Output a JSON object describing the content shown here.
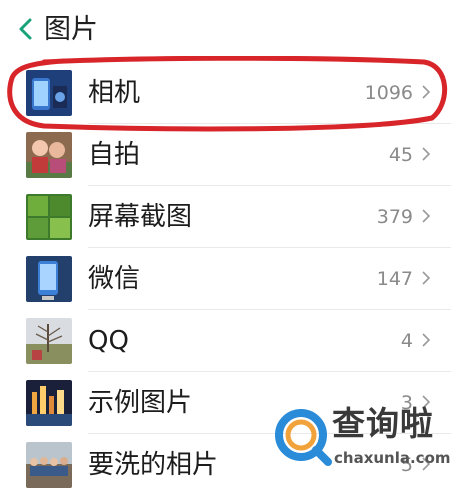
{
  "header": {
    "title": "图片",
    "back_icon": "chevron-left-icon",
    "accent": "#1aa37a"
  },
  "albums": [
    {
      "label": "相机",
      "count": "1096",
      "icon": "camera-album-thumb"
    },
    {
      "label": "自拍",
      "count": "45",
      "icon": "selfie-album-thumb"
    },
    {
      "label": "屏幕截图",
      "count": "379",
      "icon": "screenshot-album-thumb"
    },
    {
      "label": "微信",
      "count": "147",
      "icon": "wechat-album-thumb"
    },
    {
      "label": "QQ",
      "count": "4",
      "icon": "qq-album-thumb"
    },
    {
      "label": "示例图片",
      "count": "3",
      "icon": "sample-album-thumb"
    },
    {
      "label": "要洗的相片",
      "count": "5",
      "icon": "print-album-thumb"
    }
  ],
  "annotation": {
    "color": "#d8252a"
  },
  "watermark": {
    "cn": "查询啦",
    "en": "chaxunla.com",
    "color": "#2a8bd8"
  }
}
